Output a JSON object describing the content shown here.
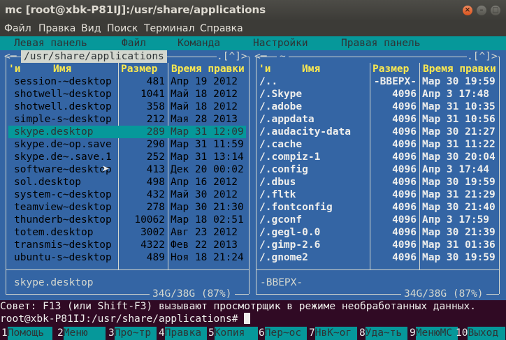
{
  "window": {
    "title": "mc [root@xbk-P81IJ]:/usr/share/applications"
  },
  "menu": [
    "Файл",
    "Правка",
    "Вид",
    "Поиск",
    "Терминал",
    "Справка"
  ],
  "mc_menu": [
    "Левая панель",
    "Файл",
    "Команда",
    "Настройки",
    "Правая панель"
  ],
  "left_panel": {
    "path": "/usr/share/applications",
    "corner": ".[^]>",
    "headers": {
      "sort": "'и",
      "name": "Имя",
      "size": "Размер",
      "time": "Время правки"
    },
    "rows": [
      {
        "name": "session-~desktop",
        "size": "481",
        "time": "Апр 19  2012"
      },
      {
        "name": "shotwell~desktop",
        "size": "1041",
        "time": "Май 18  2012"
      },
      {
        "name": "shotwell.desktop",
        "size": "358",
        "time": "Май 18  2012"
      },
      {
        "name": "simple-s~desktop",
        "size": "212",
        "time": "Мая 28  2013"
      },
      {
        "name": "skype.desktop",
        "size": "289",
        "time": "Мар 31 12:09",
        "selected": true
      },
      {
        "name": "skype.de~op.save",
        "size": "290",
        "time": "Мар 31 11:59"
      },
      {
        "name": "skype.de~.save.1",
        "size": "252",
        "time": "Мар 31 13:14"
      },
      {
        "name": "software~desktop",
        "size": "413",
        "time": "Дек 20 00:02"
      },
      {
        "name": "sol.desktop",
        "size": "498",
        "time": "Апр 16  2012"
      },
      {
        "name": "system-c~desktop",
        "size": "432",
        "time": "Май 30  2012"
      },
      {
        "name": "teamview~desktop",
        "size": "278",
        "time": "Мар 30 21:30"
      },
      {
        "name": "thunderb~desktop",
        "size": "10062",
        "time": "Мар 18 02:51"
      },
      {
        "name": "totem.desktop",
        "size": "3002",
        "time": "Авг 23  2012"
      },
      {
        "name": "transmis~desktop",
        "size": "4322",
        "time": "Фев 22  2013"
      },
      {
        "name": "ubuntu-s~desktop",
        "size": "489",
        "time": "Ноя 18 21:24"
      }
    ],
    "mini_status": "skype.desktop",
    "disk": "34G/38G (87%)"
  },
  "right_panel": {
    "path": "~",
    "corner": ".[^]>",
    "headers": {
      "sort": "'и",
      "name": "Имя",
      "size": "Размер",
      "time": "Время правки"
    },
    "rows": [
      {
        "name": "/..",
        "size": "-ВВЕРХ-",
        "time": "Мар 30 19:59"
      },
      {
        "name": "/.Skype",
        "size": "4096",
        "time": "Апр  3 17:48"
      },
      {
        "name": "/.adobe",
        "size": "4096",
        "time": "Мар 31 10:35"
      },
      {
        "name": "/.appdata",
        "size": "4096",
        "time": "Мар 31 10:56"
      },
      {
        "name": "/.audacity-data",
        "size": "4096",
        "time": "Мар 30 21:27"
      },
      {
        "name": "/.cache",
        "size": "4096",
        "time": "Мар 31 11:22"
      },
      {
        "name": "/.compiz-1",
        "size": "4096",
        "time": "Мар 30 20:04"
      },
      {
        "name": "/.config",
        "size": "4096",
        "time": "Апр  3 17:44"
      },
      {
        "name": "/.dbus",
        "size": "4096",
        "time": "Мар 30 19:59"
      },
      {
        "name": "/.fltk",
        "size": "4096",
        "time": "Мар 31 21:29"
      },
      {
        "name": "/.fontconfig",
        "size": "4096",
        "time": "Мар 30 21:40"
      },
      {
        "name": "/.gconf",
        "size": "4096",
        "time": "Апр  3 17:59"
      },
      {
        "name": "/.gegl-0.0",
        "size": "4096",
        "time": "Мар 30 21:39"
      },
      {
        "name": "/.gimp-2.6",
        "size": "4096",
        "time": "Мар 31 01:36"
      },
      {
        "name": "/.gnome2",
        "size": "4096",
        "time": "Мар 30 19:59"
      }
    ],
    "mini_status": "-ВВЕРХ-",
    "disk": "34G/38G (87%)"
  },
  "hint": "Совет: F13 (или Shift-F3) вызывают просмотрщик в режиме необработанных данных.",
  "prompt": "root@xbk-P81IJ:/usr/share/applications#",
  "fkeys": [
    {
      "num": "1",
      "label": "Помощь"
    },
    {
      "num": "2",
      "label": "Меню"
    },
    {
      "num": "3",
      "label": "Про~тр"
    },
    {
      "num": "4",
      "label": "Правка"
    },
    {
      "num": "5",
      "label": "Копия"
    },
    {
      "num": "6",
      "label": "Пер~ос"
    },
    {
      "num": "7",
      "label": "НвК~ог"
    },
    {
      "num": "8",
      "label": "Уда~ть"
    },
    {
      "num": "9",
      "label": "МенюMC"
    },
    {
      "num": "10",
      "label": "Выход"
    }
  ],
  "colors": {
    "panel": "#3465a4",
    "accent": "#06989a",
    "header": "#fce94f",
    "terminal_bg": "#300a24"
  }
}
